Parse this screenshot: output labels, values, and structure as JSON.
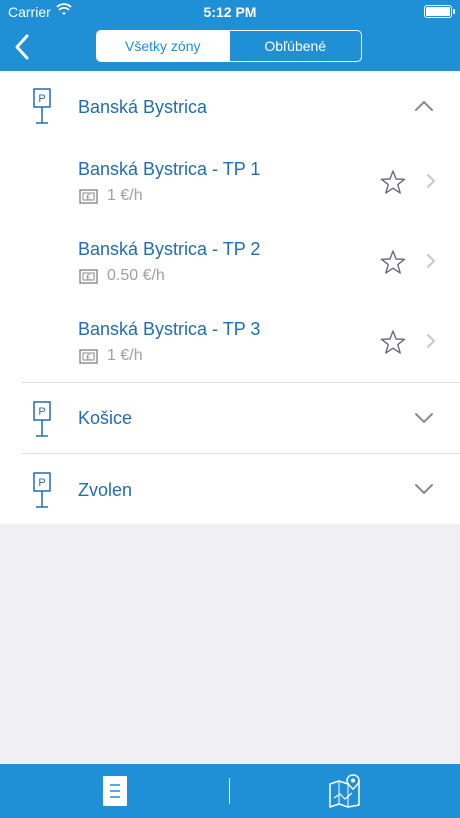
{
  "status_bar": {
    "carrier": "Carrier",
    "time": "5:12 PM"
  },
  "segmented": {
    "all_label": "Všetky zóny",
    "favorites_label": "Obľúbené",
    "selected": "all"
  },
  "zones": [
    {
      "name": "Banská Bystrica",
      "expanded": true,
      "sub_zones": [
        {
          "name": "Banská Bystrica - TP 1",
          "price": "1 €/h"
        },
        {
          "name": "Banská Bystrica - TP 2",
          "price": "0.50 €/h"
        },
        {
          "name": "Banská Bystrica - TP 3",
          "price": "1 €/h"
        }
      ]
    },
    {
      "name": "Košice",
      "expanded": false
    },
    {
      "name": "Zvolen",
      "expanded": false
    }
  ],
  "icons": {
    "back": "back-chevron-icon",
    "parking": "parking-sign-icon",
    "money": "money-icon",
    "favorite": "star-outline-icon",
    "tab_list": "document-list-icon",
    "tab_map": "map-pin-icon"
  },
  "colors": {
    "accent": "#1f8fd6",
    "text_blue": "#1f6db6",
    "muted": "#a0a0a5"
  }
}
